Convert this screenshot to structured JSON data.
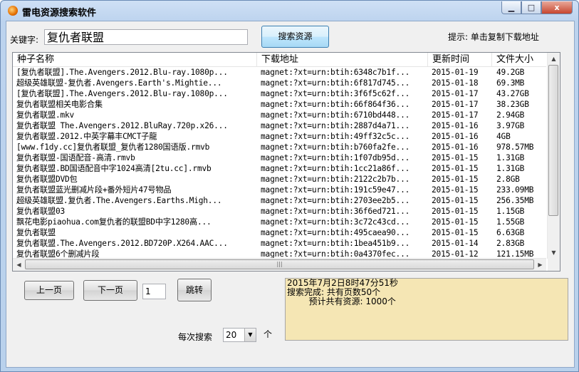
{
  "window": {
    "title": "雷电资源搜索软件",
    "min_label": "▁",
    "max_label": "□",
    "close_label": "x"
  },
  "search": {
    "label": "关键字:",
    "value": "复仇者联盟",
    "button": "搜索资源",
    "hint": "提示: 单击复制下载地址"
  },
  "table": {
    "columns": [
      "种子名称",
      "下载地址",
      "更新时间",
      "文件大小"
    ],
    "rows": [
      [
        "[复仇者联盟].The.Avengers.2012.Blu-ray.1080p...",
        "magnet:?xt=urn:btih:6348c7b1f...",
        "2015-01-19",
        "49.2GB"
      ],
      [
        "超级英雄联盟-复仇者.Avengers.Earth's.Mightie...",
        "magnet:?xt=urn:btih:6f817d745...",
        "2015-01-18",
        "69.3MB"
      ],
      [
        "[复仇者联盟].The.Avengers.2012.Blu-ray.1080p...",
        "magnet:?xt=urn:btih:3f6f5c62f...",
        "2015-01-17",
        "43.27GB"
      ],
      [
        "复仇者联盟相关电影合集",
        "magnet:?xt=urn:btih:66f864f36...",
        "2015-01-17",
        "38.23GB"
      ],
      [
        "复仇者联盟.mkv",
        "magnet:?xt=urn:btih:6710bd448...",
        "2015-01-17",
        "2.94GB"
      ],
      [
        "复仇者联盟 The.Avengers.2012.BluRay.720p.x26...",
        "magnet:?xt=urn:btih:2887d4a71...",
        "2015-01-16",
        "3.97GB"
      ],
      [
        "复仇者联盟.2012.中英字幕丰CMCT子龍",
        "magnet:?xt=urn:btih:49ff32c5c...",
        "2015-01-16",
        "4GB"
      ],
      [
        "[www.f1dy.cc]复仇者联盟_复仇者1280国语版.rmvb",
        "magnet:?xt=urn:btih:b760fa2fe...",
        "2015-01-16",
        "978.57MB"
      ],
      [
        "复仇者联盟-国语配音-高清.rmvb",
        "magnet:?xt=urn:btih:1f07db95d...",
        "2015-01-15",
        "1.31GB"
      ],
      [
        "复仇者联盟.BD国语配音中字1024高清[2tu.cc].rmvb",
        "magnet:?xt=urn:btih:1cc21a86f...",
        "2015-01-15",
        "1.31GB"
      ],
      [
        "复仇者联盟DVD包",
        "magnet:?xt=urn:btih:2122c2b7b...",
        "2015-01-15",
        "2.8GB"
      ],
      [
        "复仇者联盟蓝光删减片段+番外短片47号物品",
        "magnet:?xt=urn:btih:191c59e47...",
        "2015-01-15",
        "233.09MB"
      ],
      [
        "超级英雄联盟.复仇者.The.Avengers.Earths.Migh...",
        "magnet:?xt=urn:btih:2703ee2b5...",
        "2015-01-15",
        "256.35MB"
      ],
      [
        "复仇者联盟03",
        "magnet:?xt=urn:btih:36f6ed721...",
        "2015-01-15",
        "1.15GB"
      ],
      [
        "飘花电影piaohua.com复仇者的联盟BD中字1280高...",
        "magnet:?xt=urn:btih:3c72c43cd...",
        "2015-01-15",
        "1.55GB"
      ],
      [
        "复仇者联盟",
        "magnet:?xt=urn:btih:495caea90...",
        "2015-01-15",
        "6.63GB"
      ],
      [
        "复仇者联盟.The.Avengers.2012.BD720P.X264.AAC...",
        "magnet:?xt=urn:btih:1bea451b9...",
        "2015-01-14",
        "2.83GB"
      ],
      [
        "复仇者联盟6个删减片段",
        "magnet:?xt=urn:btih:0a4370fec...",
        "2015-01-12",
        "121.15MB"
      ]
    ]
  },
  "pager": {
    "prev": "上一页",
    "next": "下一页",
    "page_value": "1",
    "go": "跳转"
  },
  "status": {
    "line1": "2015年7月2日8时47分51秒",
    "line2": "搜索完成: 共有页数50个",
    "line3": "        预计共有资源: 1000个"
  },
  "per_search": {
    "label": "每次搜索",
    "value": "20",
    "unit": "个"
  },
  "colors": {
    "status_bg": "#f5e6b4",
    "search_button": "#bee6fd"
  }
}
